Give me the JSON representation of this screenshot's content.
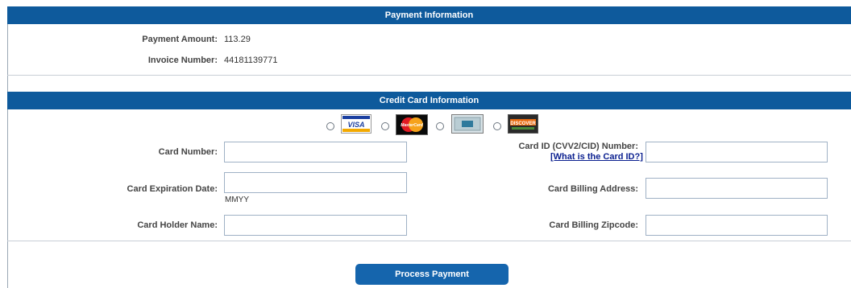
{
  "payment": {
    "header": "Payment Information",
    "amount_label": "Payment Amount:",
    "amount_value": "113.29",
    "invoice_label": "Invoice Number:",
    "invoice_value": "44181139771"
  },
  "card": {
    "header": "Credit Card Information",
    "logos": [
      {
        "label": "VISA",
        "icon": "visa-logo"
      },
      {
        "label": "MasterCard",
        "icon": "mastercard-logo"
      },
      {
        "label": "",
        "icon": "amex-logo"
      },
      {
        "label": "DISCOVER",
        "icon": "discover-logo"
      }
    ],
    "number_label": "Card Number:",
    "number_value": "",
    "expiration_label": "Card Expiration Date:",
    "expiration_value": "",
    "expiration_hint": "MMYY",
    "holder_label": "Card Holder Name:",
    "holder_value": "",
    "cvv_label": "Card ID (CVV2/CID) Number:",
    "cvv_link": "[What is the Card ID?]",
    "cvv_value": "",
    "billing_address_label": "Card Billing Address:",
    "billing_address_value": "",
    "billing_zip_label": "Card Billing Zipcode:",
    "billing_zip_value": ""
  },
  "submit_label": "Process Payment",
  "colors": {
    "header_bar": "#0e5a9c",
    "button": "#1565ad",
    "link": "#0a1f8f"
  }
}
